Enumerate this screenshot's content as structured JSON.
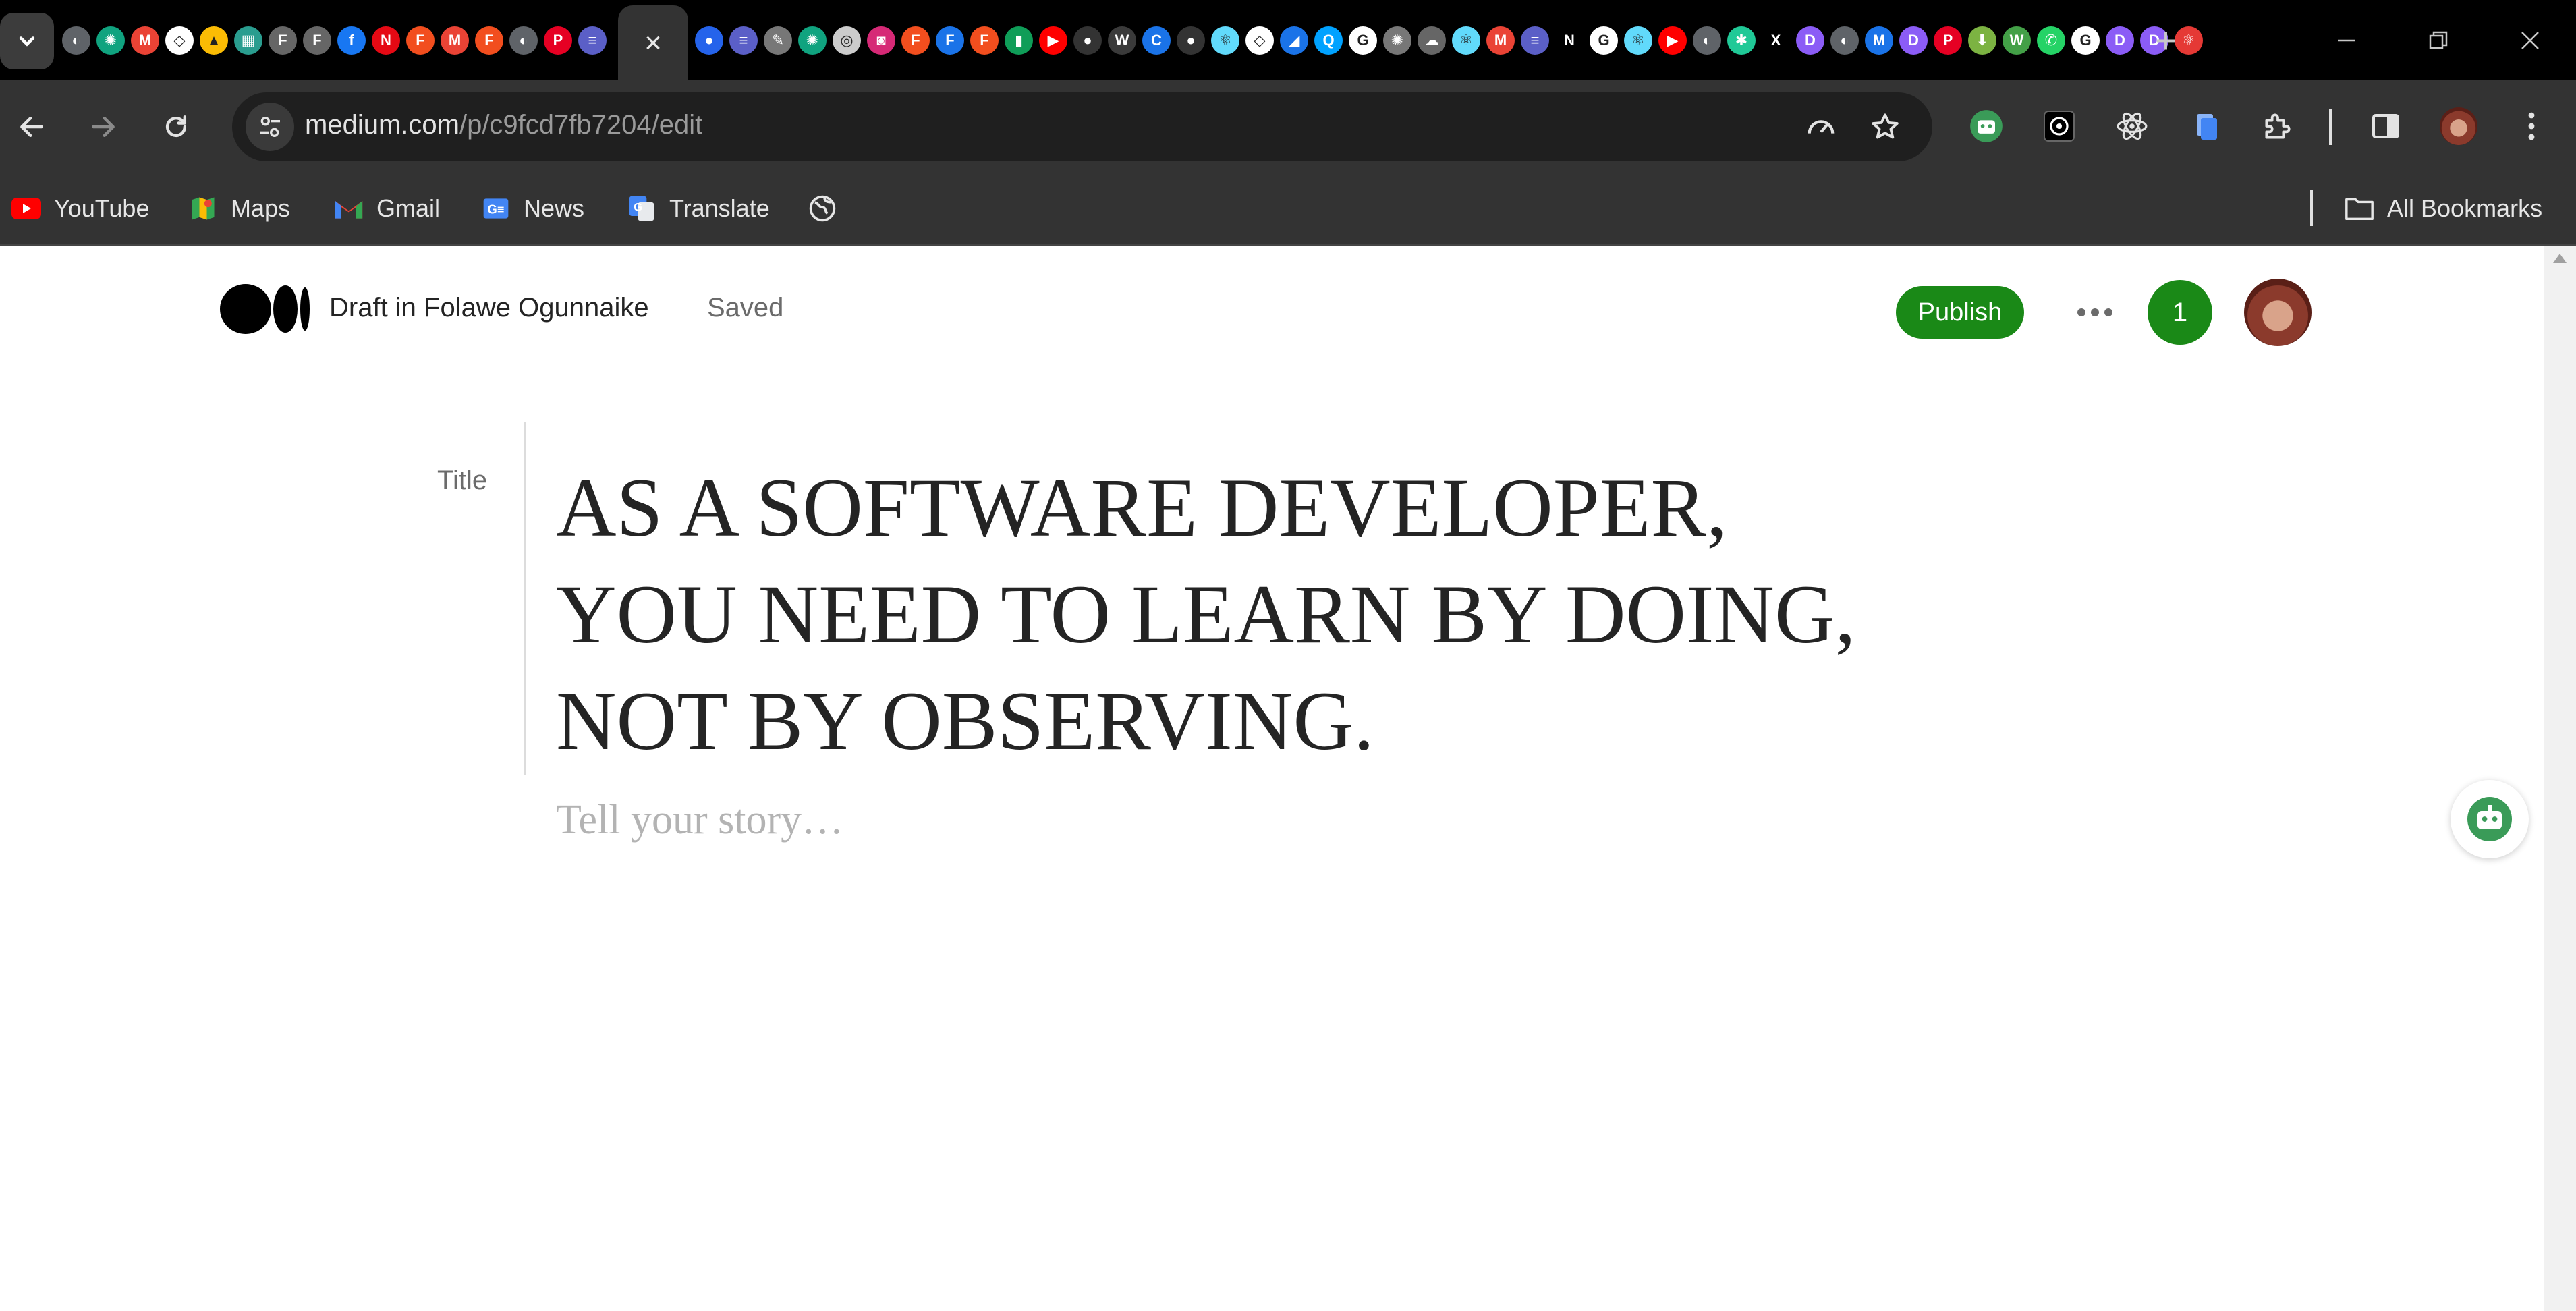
{
  "browser": {
    "tabs": {
      "active_close_label": "×",
      "favicons_left": [
        {
          "name": "chrome",
          "color": "#5f6368",
          "glyph": "◐"
        },
        {
          "name": "chatgpt",
          "color": "#10a37f",
          "glyph": "✺"
        },
        {
          "name": "gmail",
          "color": "#ea4335",
          "glyph": "M"
        },
        {
          "name": "codepen",
          "color": "#ffffff",
          "glyph": "◇"
        },
        {
          "name": "google-drive",
          "color": "#fbbc04",
          "glyph": "▲"
        },
        {
          "name": "slides",
          "color": "#2a9d8f",
          "glyph": "▦"
        },
        {
          "name": "figma-ring",
          "color": "#666666",
          "glyph": "F"
        },
        {
          "name": "figma-ring-2",
          "color": "#666666",
          "glyph": "F"
        },
        {
          "name": "facebook",
          "color": "#1877f2",
          "glyph": "f"
        },
        {
          "name": "netflix",
          "color": "#e50914",
          "glyph": "N"
        },
        {
          "name": "figma",
          "color": "#f24e1e",
          "glyph": "F"
        },
        {
          "name": "gmail-2",
          "color": "#ea4335",
          "glyph": "M"
        },
        {
          "name": "figma-2",
          "color": "#f24e1e",
          "glyph": "F"
        },
        {
          "name": "chrome-2",
          "color": "#5f6368",
          "glyph": "◐"
        },
        {
          "name": "pinterest",
          "color": "#e60023",
          "glyph": "P"
        },
        {
          "name": "list",
          "color": "#5b5fc7",
          "glyph": "≡"
        }
      ],
      "favicons_right": [
        {
          "name": "react-blue",
          "color": "#2563eb",
          "glyph": "●"
        },
        {
          "name": "list",
          "color": "#5b5fc7",
          "glyph": "≡"
        },
        {
          "name": "feather",
          "color": "#777777",
          "glyph": "✎"
        },
        {
          "name": "chatgpt",
          "color": "#10a37f",
          "glyph": "✺"
        },
        {
          "name": "github-ring",
          "color": "#cccccc",
          "glyph": "◎"
        },
        {
          "name": "instagram",
          "color": "#d62976",
          "glyph": "◙"
        },
        {
          "name": "figma",
          "color": "#f24e1e",
          "glyph": "F"
        },
        {
          "name": "forms",
          "color": "#1a73e8",
          "glyph": "F"
        },
        {
          "name": "figma-2",
          "color": "#f24e1e",
          "glyph": "F"
        },
        {
          "name": "green-doc",
          "color": "#0f9d58",
          "glyph": "▮"
        },
        {
          "name": "youtube",
          "color": "#ff0000",
          "glyph": "▶"
        },
        {
          "name": "github",
          "color": "#333333",
          "glyph": "●"
        },
        {
          "name": "whatsapp-web",
          "color": "#3a3a3a",
          "glyph": "W"
        },
        {
          "name": "c-blue",
          "color": "#1a73e8",
          "glyph": "C"
        },
        {
          "name": "github-2",
          "color": "#333333",
          "glyph": "●"
        },
        {
          "name": "react",
          "color": "#61dafb",
          "glyph": "⚛"
        },
        {
          "name": "codepen",
          "color": "#ffffff",
          "glyph": "◇"
        },
        {
          "name": "vercel",
          "color": "#1a73e8",
          "glyph": "◢"
        },
        {
          "name": "search",
          "color": "#00a2ff",
          "glyph": "Q"
        },
        {
          "name": "google",
          "color": "#ffffff",
          "glyph": "G"
        },
        {
          "name": "chatgpt-gray",
          "color": "#777777",
          "glyph": "✺"
        },
        {
          "name": "cloud",
          "color": "#666666",
          "glyph": "☁"
        },
        {
          "name": "react-2",
          "color": "#61dafb",
          "glyph": "⚛"
        },
        {
          "name": "gmail",
          "color": "#ea4335",
          "glyph": "M"
        },
        {
          "name": "list-2",
          "color": "#5b5fc7",
          "glyph": "≡"
        },
        {
          "name": "notion",
          "color": "#000000",
          "glyph": "N"
        },
        {
          "name": "google-2",
          "color": "#ffffff",
          "glyph": "G"
        },
        {
          "name": "react-3",
          "color": "#61dafb",
          "glyph": "⚛"
        },
        {
          "name": "youtube-2",
          "color": "#ff0000",
          "glyph": "▶"
        },
        {
          "name": "chrome",
          "color": "#5f6368",
          "glyph": "◐"
        },
        {
          "name": "perplexity",
          "color": "#20c997",
          "glyph": "✱"
        },
        {
          "name": "x",
          "color": "#000000",
          "glyph": "X"
        },
        {
          "name": "d-purple",
          "color": "#8b5cf6",
          "glyph": "D"
        },
        {
          "name": "chrome-2",
          "color": "#5f6368",
          "glyph": "◐"
        },
        {
          "name": "m-blue",
          "color": "#1a73e8",
          "glyph": "M"
        },
        {
          "name": "d-purple-2",
          "color": "#8b5cf6",
          "glyph": "D"
        },
        {
          "name": "pinterest",
          "color": "#e60023",
          "glyph": "P"
        },
        {
          "name": "download",
          "color": "#7cb342",
          "glyph": "⬇"
        },
        {
          "name": "w-green",
          "color": "#43a047",
          "glyph": "W"
        },
        {
          "name": "whatsapp",
          "color": "#25d366",
          "glyph": "✆"
        },
        {
          "name": "google-3",
          "color": "#ffffff",
          "glyph": "G"
        },
        {
          "name": "d-purple-3",
          "color": "#8b5cf6",
          "glyph": "D"
        },
        {
          "name": "d-purple-4",
          "color": "#8b5cf6",
          "glyph": "D"
        },
        {
          "name": "react-red",
          "color": "#e53935",
          "glyph": "⚛"
        }
      ],
      "new_tab_label": "+"
    },
    "address_bar": {
      "domain": "medium.com",
      "path": "/p/c9fcd7fb7204/edit"
    },
    "bookmarks": [
      {
        "label": "YouTube",
        "icon": "youtube-icon",
        "color": "#ff0000"
      },
      {
        "label": "Maps",
        "icon": "maps-icon",
        "color": "#34a853"
      },
      {
        "label": "Gmail",
        "icon": "gmail-icon",
        "color": "#ea4335"
      },
      {
        "label": "News",
        "icon": "news-icon",
        "color": "#4285f4"
      },
      {
        "label": "Translate",
        "icon": "translate-icon",
        "color": "#4285f4"
      },
      {
        "label": "",
        "icon": "globe-icon",
        "color": "#e6e6e6"
      }
    ],
    "all_bookmarks_label": "All Bookmarks"
  },
  "editor": {
    "draft_label": "Draft in Folawe Ogunnaike",
    "saved_label": "Saved",
    "publish_label": "Publish",
    "notification_count": "1",
    "title_label": "Title",
    "title_lines": [
      "AS A SOFTWARE DEVELOPER,",
      "YOU NEED TO LEARN BY DOING,",
      "NOT BY OBSERVING."
    ],
    "body_placeholder": "Tell your story…"
  },
  "colors": {
    "accent_green": "#1a8917",
    "tab_bg": "#000000",
    "toolbar_bg": "#333333"
  }
}
